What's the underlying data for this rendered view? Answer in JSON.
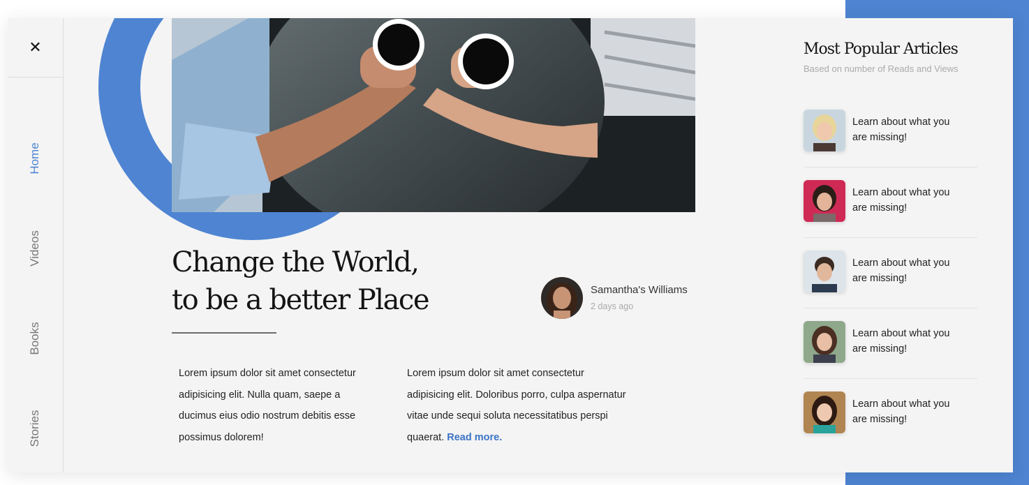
{
  "sidebar": {
    "close_symbol": "✕",
    "items": [
      {
        "label": "Home",
        "active": true
      },
      {
        "label": "Videos",
        "active": false
      },
      {
        "label": "Books",
        "active": false
      },
      {
        "label": "Stories",
        "active": false
      }
    ]
  },
  "article": {
    "title_lines": [
      "Change the World,",
      "to be a better Place"
    ],
    "author": {
      "name": "Samantha's Williams",
      "time": "2 days ago"
    },
    "col1_lines": [
      "Lorem ipsum dolor sit amet consectetur",
      "adipisicing elit. Nulla quam, saepe a",
      "ducimus eius odio nostrum debitis esse",
      "possimus dolorem!"
    ],
    "col2_lines": [
      "Lorem ipsum dolor sit amet consectetur",
      "adipisicing elit. Doloribus porro, culpa aspernatur",
      "vitae unde sequi soluta necessitatibus perspi",
      "quaerat."
    ],
    "read_more": "Read more."
  },
  "popular": {
    "title": "Most Popular Articles",
    "subtitle": "Based on number of Reads and Views",
    "items": [
      {
        "line1": "Learn about what you",
        "line2": "are missing!"
      },
      {
        "line1": "Learn about what you",
        "line2": "are missing!"
      },
      {
        "line1": "Learn about what you",
        "line2": "are missing!"
      },
      {
        "line1": "Learn about what you",
        "line2": "are missing!"
      },
      {
        "line1": "Learn about what you",
        "line2": "are missing!"
      }
    ]
  },
  "colors": {
    "accent": "#4e84d2",
    "link": "#3b73c4",
    "card_bg": "#f4f4f4"
  }
}
